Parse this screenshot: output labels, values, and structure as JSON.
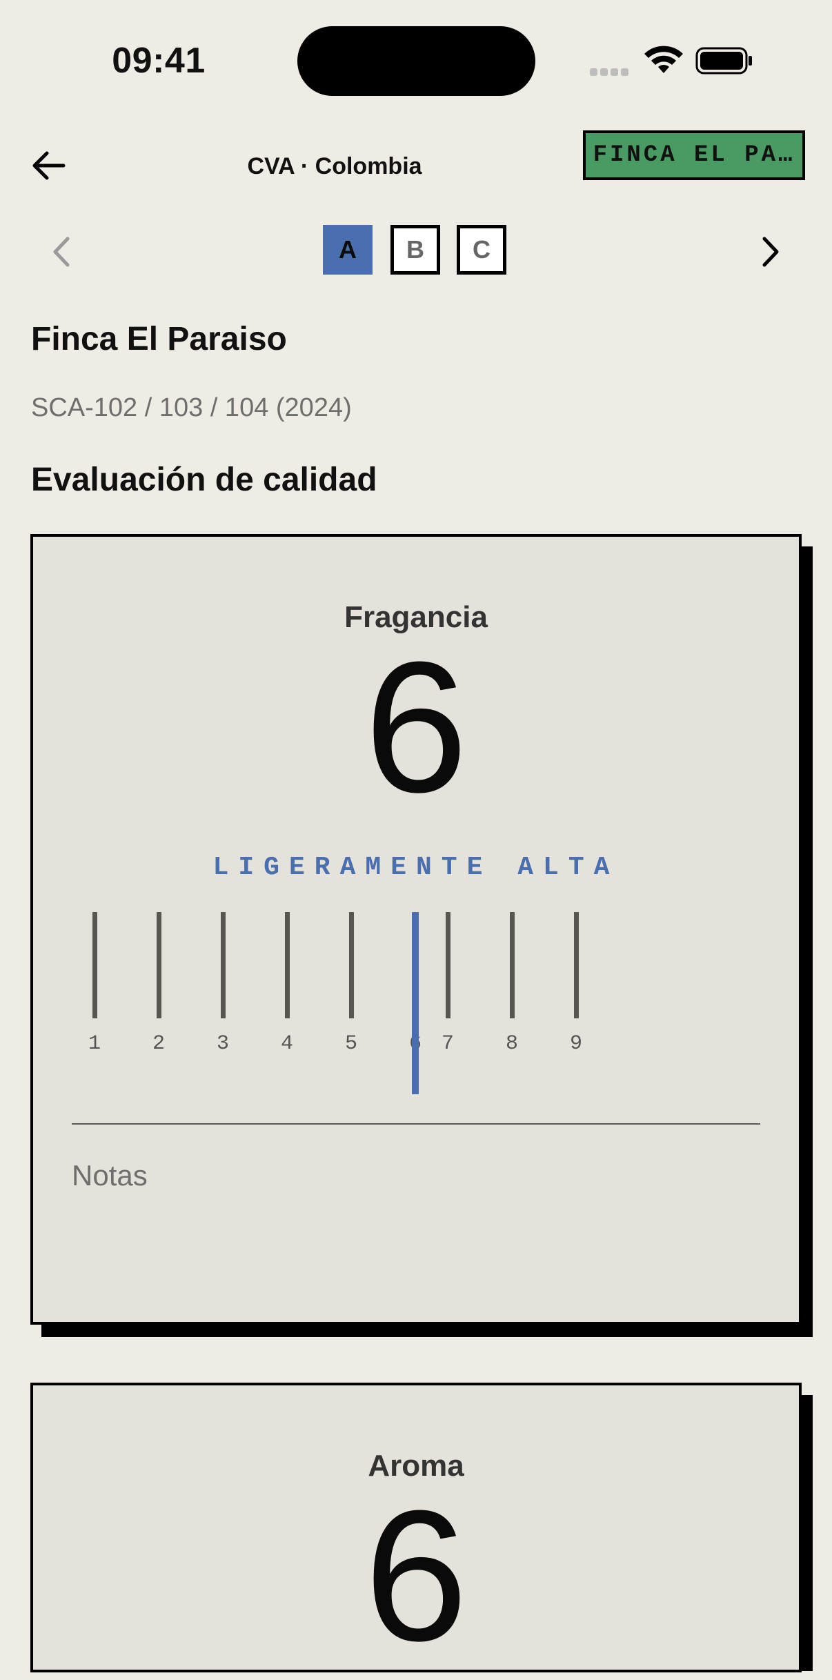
{
  "status_bar": {
    "time": "09:41"
  },
  "header": {
    "title": "CVA · Colombia",
    "tag": "FINCA EL PA…"
  },
  "samples": {
    "items": [
      "A",
      "B",
      "C"
    ],
    "selected": "A"
  },
  "farm": {
    "name": "Finca El Paraiso",
    "codes": "SCA-102 / 103 / 104 (2024)"
  },
  "section_title": "Evaluación de calidad",
  "attributes": [
    {
      "name": "Fragancia",
      "score": "6",
      "level": "LIGERAMENTE ALTA",
      "scale": [
        "1",
        "2",
        "3",
        "4",
        "5",
        "6",
        "7",
        "8",
        "9"
      ],
      "selected_value": 6,
      "notes_placeholder": "Notas"
    },
    {
      "name": "Aroma",
      "score": "6"
    }
  ],
  "colors": {
    "accent": "#4A6FAE",
    "tag_green": "#4A9B63",
    "background": "#EEECE4",
    "card": "#E4E2DA"
  }
}
